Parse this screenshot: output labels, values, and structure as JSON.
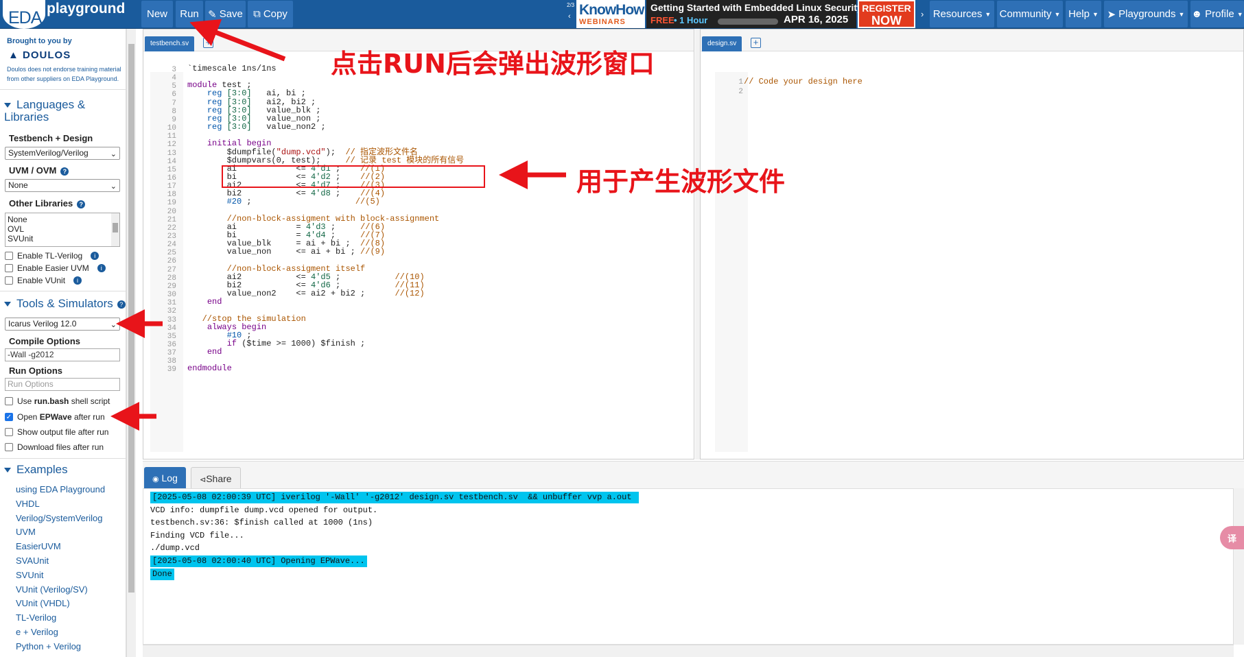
{
  "navbar": {
    "logo_eda": "EDA",
    "logo_playground": "playground",
    "buttons": {
      "new": "New",
      "run": "Run",
      "save": "Save",
      "copy": "Copy"
    },
    "banner": {
      "pager": "2/3",
      "know": "KnowHow",
      "webinars": "WEBINARS",
      "title": "Getting Started with Embedded Linux Security",
      "free": "FREE",
      "hour": "• 1 Hour",
      "date": "APR 16, 2025",
      "register": "REGISTER",
      "now": "NOW"
    },
    "menus": {
      "resources": "Resources",
      "community": "Community",
      "help": "Help",
      "playgrounds": "Playgrounds",
      "profile": "Profile"
    }
  },
  "sidebar": {
    "brought": "Brought to you by",
    "doulos": "DOULOS",
    "disclaimer": "Doulos does not endorse training material from other suppliers on EDA Playground.",
    "languages_title": "Languages & Libraries",
    "tb_design_label": "Testbench + Design",
    "tb_design_value": "SystemVerilog/Verilog",
    "uvm_label": "UVM / OVM",
    "uvm_value": "None",
    "other_libs_label": "Other Libraries",
    "other_libs": [
      "None",
      "OVL",
      "SVUnit"
    ],
    "enable_tl": "Enable TL-Verilog",
    "enable_easier": "Enable Easier UVM",
    "enable_vunit": "Enable VUnit",
    "tools_title": "Tools & Simulators",
    "simulator_value": "Icarus Verilog 12.0",
    "compile_label": "Compile Options",
    "compile_value": "-Wall -g2012",
    "run_label": "Run Options",
    "run_placeholder": "Run Options",
    "use_run_pre": "Use ",
    "use_run_bold": "run.bash",
    "use_run_post": " shell script",
    "open_pre": "Open ",
    "open_bold": "EPWave",
    "open_post": " after run",
    "show_output": "Show output file after run",
    "download_files": "Download files after run",
    "examples_title": "Examples",
    "examples": [
      "using EDA Playground",
      "VHDL",
      "Verilog/SystemVerilog",
      "UVM",
      "EasierUVM",
      "SVAUnit",
      "SVUnit",
      "VUnit (Verilog/SV)",
      "VUnit (VHDL)",
      "TL-Verilog",
      "e + Verilog",
      "Python + Verilog"
    ]
  },
  "editor": {
    "left_tab": "testbench.sv",
    "right_tab": "design.sv",
    "design_lines": [
      "// Code your design here",
      ""
    ],
    "testbench_lines": [
      {
        "n": "3",
        "t": "`timescale 1ns/1ns"
      },
      {
        "n": "4",
        "t": ""
      },
      {
        "n": "5",
        "t": "module test ;"
      },
      {
        "n": "6",
        "t": "    reg [3:0]   ai, bi ;"
      },
      {
        "n": "7",
        "t": "    reg [3:0]   ai2, bi2 ;"
      },
      {
        "n": "8",
        "t": "    reg [3:0]   value_blk ;"
      },
      {
        "n": "9",
        "t": "    reg [3:0]   value_non ;"
      },
      {
        "n": "10",
        "t": "    reg [3:0]   value_non2 ;"
      },
      {
        "n": "11",
        "t": ""
      },
      {
        "n": "12",
        "t": "    initial begin"
      },
      {
        "n": "13",
        "t": "        $dumpfile(\"dump.vcd\");  // 指定波形文件名"
      },
      {
        "n": "14",
        "t": "        $dumpvars(0, test);     // 记录 test 模块的所有信号"
      },
      {
        "n": "15",
        "t": "        ai            <= 4'd1 ;    //(1)"
      },
      {
        "n": "16",
        "t": "        bi            <= 4'd2 ;    //(2)"
      },
      {
        "n": "17",
        "t": "        ai2           <= 4'd7 ;    //(3)"
      },
      {
        "n": "18",
        "t": "        bi2           <= 4'd8 ;    //(4)"
      },
      {
        "n": "19",
        "t": "        #20 ;                     //(5)"
      },
      {
        "n": "20",
        "t": ""
      },
      {
        "n": "21",
        "t": "        //non-block-assigment with block-assignment"
      },
      {
        "n": "22",
        "t": "        ai            = 4'd3 ;     //(6)"
      },
      {
        "n": "23",
        "t": "        bi            = 4'd4 ;     //(7)"
      },
      {
        "n": "24",
        "t": "        value_blk     = ai + bi ;  //(8)"
      },
      {
        "n": "25",
        "t": "        value_non     <= ai + bi ; //(9)"
      },
      {
        "n": "26",
        "t": ""
      },
      {
        "n": "27",
        "t": "        //non-block-assigment itself"
      },
      {
        "n": "28",
        "t": "        ai2           <= 4'd5 ;           //(10)"
      },
      {
        "n": "29",
        "t": "        bi2           <= 4'd6 ;           //(11)"
      },
      {
        "n": "30",
        "t": "        value_non2    <= ai2 + bi2 ;      //(12)"
      },
      {
        "n": "31",
        "t": "    end"
      },
      {
        "n": "32",
        "t": ""
      },
      {
        "n": "33",
        "t": "   //stop the simulation"
      },
      {
        "n": "34",
        "t": "    always begin"
      },
      {
        "n": "35",
        "t": "        #10 ;"
      },
      {
        "n": "36",
        "t": "        if ($time >= 1000) $finish ;"
      },
      {
        "n": "37",
        "t": "    end"
      },
      {
        "n": "38",
        "t": ""
      },
      {
        "n": "39",
        "t": "endmodule"
      }
    ]
  },
  "log": {
    "tab_log": "Log",
    "tab_share": "Share",
    "lines": [
      {
        "t": "[2025-05-08 02:00:39 UTC] iverilog '-Wall' '-g2012' design.sv testbench.sv  && unbuffer vvp a.out ",
        "hl": true
      },
      {
        "t": "VCD info: dumpfile dump.vcd opened for output.",
        "hl": false
      },
      {
        "t": "testbench.sv:36: $finish called at 1000 (1ns)",
        "hl": false
      },
      {
        "t": "Finding VCD file...",
        "hl": false
      },
      {
        "t": "./dump.vcd",
        "hl": false
      },
      {
        "t": "[2025-05-08 02:00:40 UTC] Opening EPWave...",
        "hl": true
      },
      {
        "t": "Done",
        "hl": true
      }
    ]
  },
  "annotations": {
    "run_note": "点击RUN后会弹出波形窗口",
    "dump_note": "用于产生波形文件"
  },
  "translate_badge": "译"
}
